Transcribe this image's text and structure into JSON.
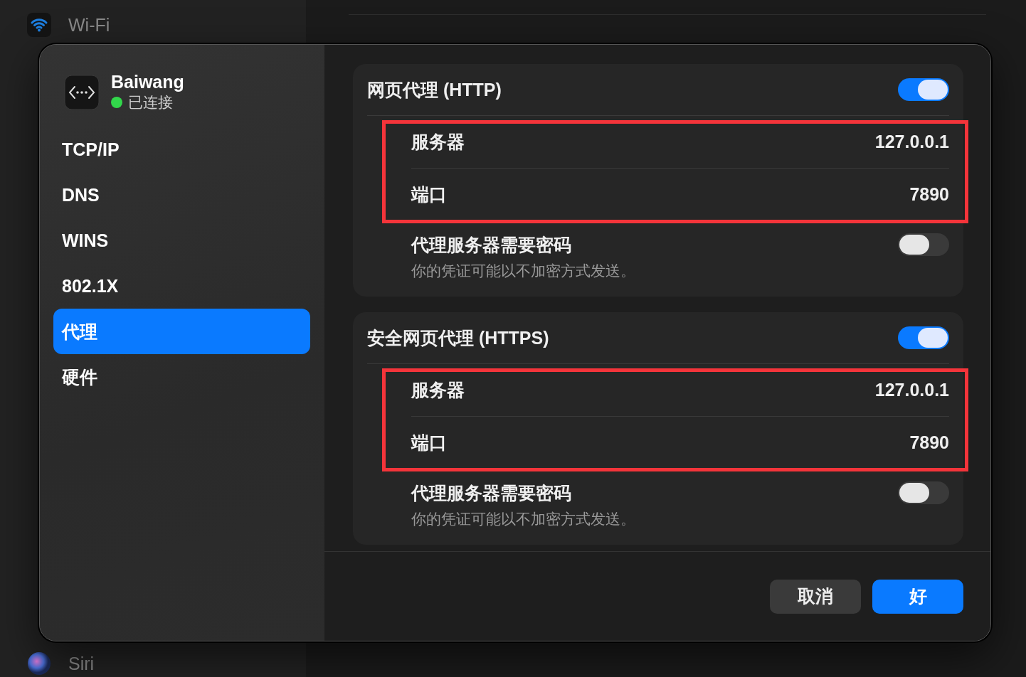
{
  "background": {
    "sidebar": [
      {
        "label": "Wi-Fi",
        "kind": "wifi"
      },
      {
        "label": "Siri",
        "kind": "siri"
      }
    ]
  },
  "sheet": {
    "network": {
      "name": "Baiwang",
      "status": "已连接"
    },
    "nav": [
      {
        "label": "TCP/IP",
        "selected": false
      },
      {
        "label": "DNS",
        "selected": false
      },
      {
        "label": "WINS",
        "selected": false
      },
      {
        "label": "802.1X",
        "selected": false
      },
      {
        "label": "代理",
        "selected": true
      },
      {
        "label": "硬件",
        "selected": false
      }
    ],
    "sections": [
      {
        "title": "网页代理 (HTTP)",
        "on": true,
        "highlighted": true,
        "fields": [
          {
            "label": "服务器",
            "value": "127.0.0.1"
          },
          {
            "label": "端口",
            "value": "7890"
          }
        ],
        "password": {
          "label": "代理服务器需要密码",
          "note": "你的凭证可能以不加密方式发送。",
          "on": false
        }
      },
      {
        "title": "安全网页代理 (HTTPS)",
        "on": true,
        "highlighted": true,
        "fields": [
          {
            "label": "服务器",
            "value": "127.0.0.1"
          },
          {
            "label": "端口",
            "value": "7890"
          }
        ],
        "password": {
          "label": "代理服务器需要密码",
          "note": "你的凭证可能以不加密方式发送。",
          "on": false
        }
      }
    ],
    "buttons": [
      {
        "label": "取消",
        "kind": "secondary"
      },
      {
        "label": "好",
        "kind": "primary"
      }
    ]
  }
}
